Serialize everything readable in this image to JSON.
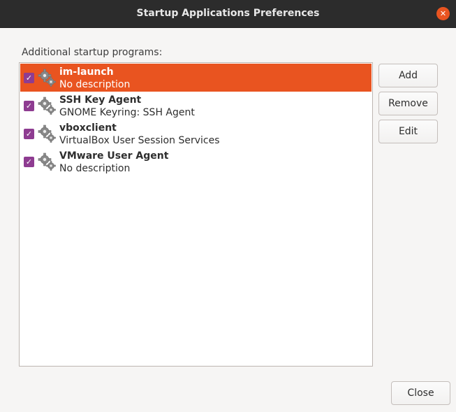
{
  "window": {
    "title": "Startup Applications Preferences"
  },
  "list": {
    "label": "Additional startup programs:",
    "items": [
      {
        "name": "im-launch",
        "description": "No description",
        "enabled": true,
        "selected": true
      },
      {
        "name": "SSH Key Agent",
        "description": "GNOME Keyring: SSH Agent",
        "enabled": true,
        "selected": false
      },
      {
        "name": "vboxclient",
        "description": "VirtualBox User Session Services",
        "enabled": true,
        "selected": false
      },
      {
        "name": "VMware User Agent",
        "description": "No description",
        "enabled": true,
        "selected": false
      }
    ],
    "item_icon": "gears-icon"
  },
  "buttons": {
    "add": "Add",
    "remove": "Remove",
    "edit": "Edit",
    "close": "Close"
  },
  "colors": {
    "accent": "#e95420",
    "checkbox": "#8e3c91",
    "titlebar": "#2c2c2c"
  }
}
